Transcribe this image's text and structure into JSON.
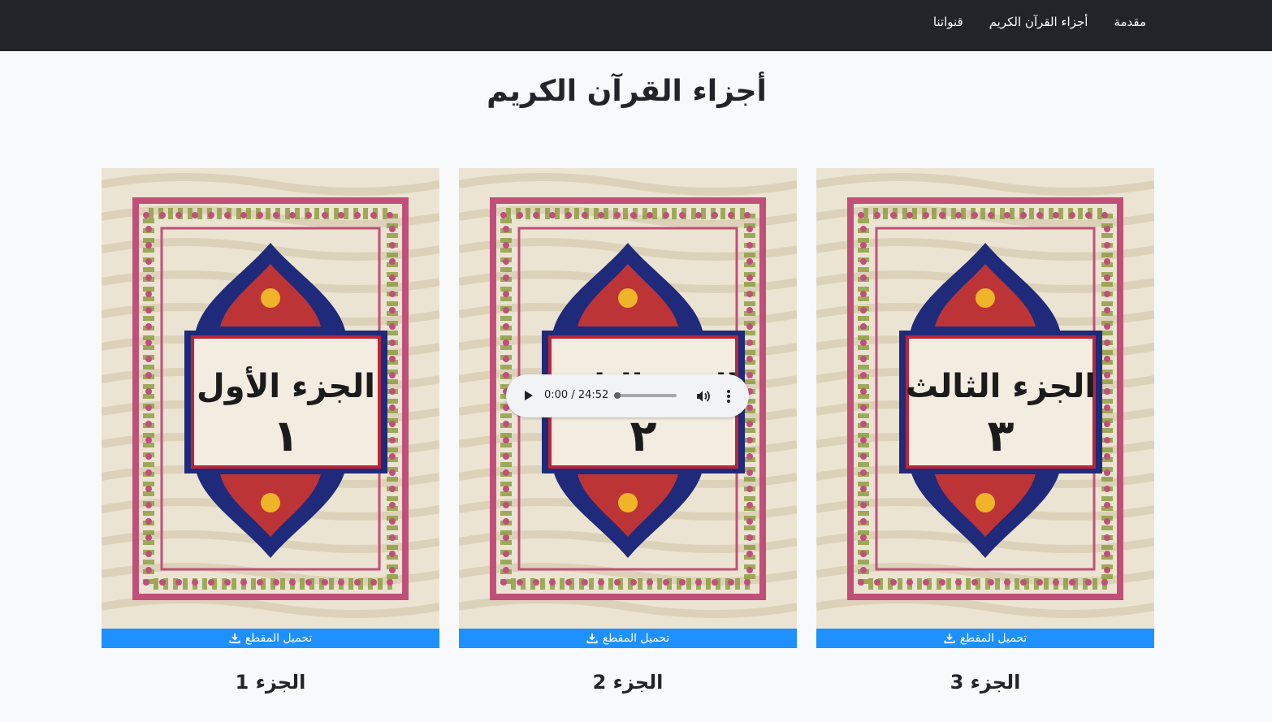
{
  "nav": {
    "items": [
      {
        "label": "مقدمة"
      },
      {
        "label": "أجزاء القرآن الكريم"
      },
      {
        "label": "قنواتنا"
      }
    ]
  },
  "page": {
    "title": "أجزاء القرآن الكريم"
  },
  "cards": [
    {
      "title": "الجزء 1",
      "cover_text": "الجزء الأول",
      "cover_number": "١",
      "download_label": "تحميل المقطع"
    },
    {
      "title": "الجزء 2",
      "cover_text": "الجزء الثاني",
      "cover_number": "٢",
      "download_label": "تحميل المقطع"
    },
    {
      "title": "الجزء 3",
      "cover_text": "الجزء الثالث",
      "cover_number": "٣",
      "download_label": "تحميل المقطع"
    }
  ],
  "audio_player": {
    "time": "0:00 / 24:52",
    "progress": 0
  },
  "colors": {
    "navbar": "#212529",
    "download_button": "#1e90ff",
    "background": "#f8f9fa",
    "frame_navy": "#1f2a7a",
    "frame_pink": "#c0507a"
  },
  "icons": {
    "download": "download-icon",
    "play": "play-icon",
    "volume": "volume-icon",
    "more": "more-vert-icon"
  }
}
